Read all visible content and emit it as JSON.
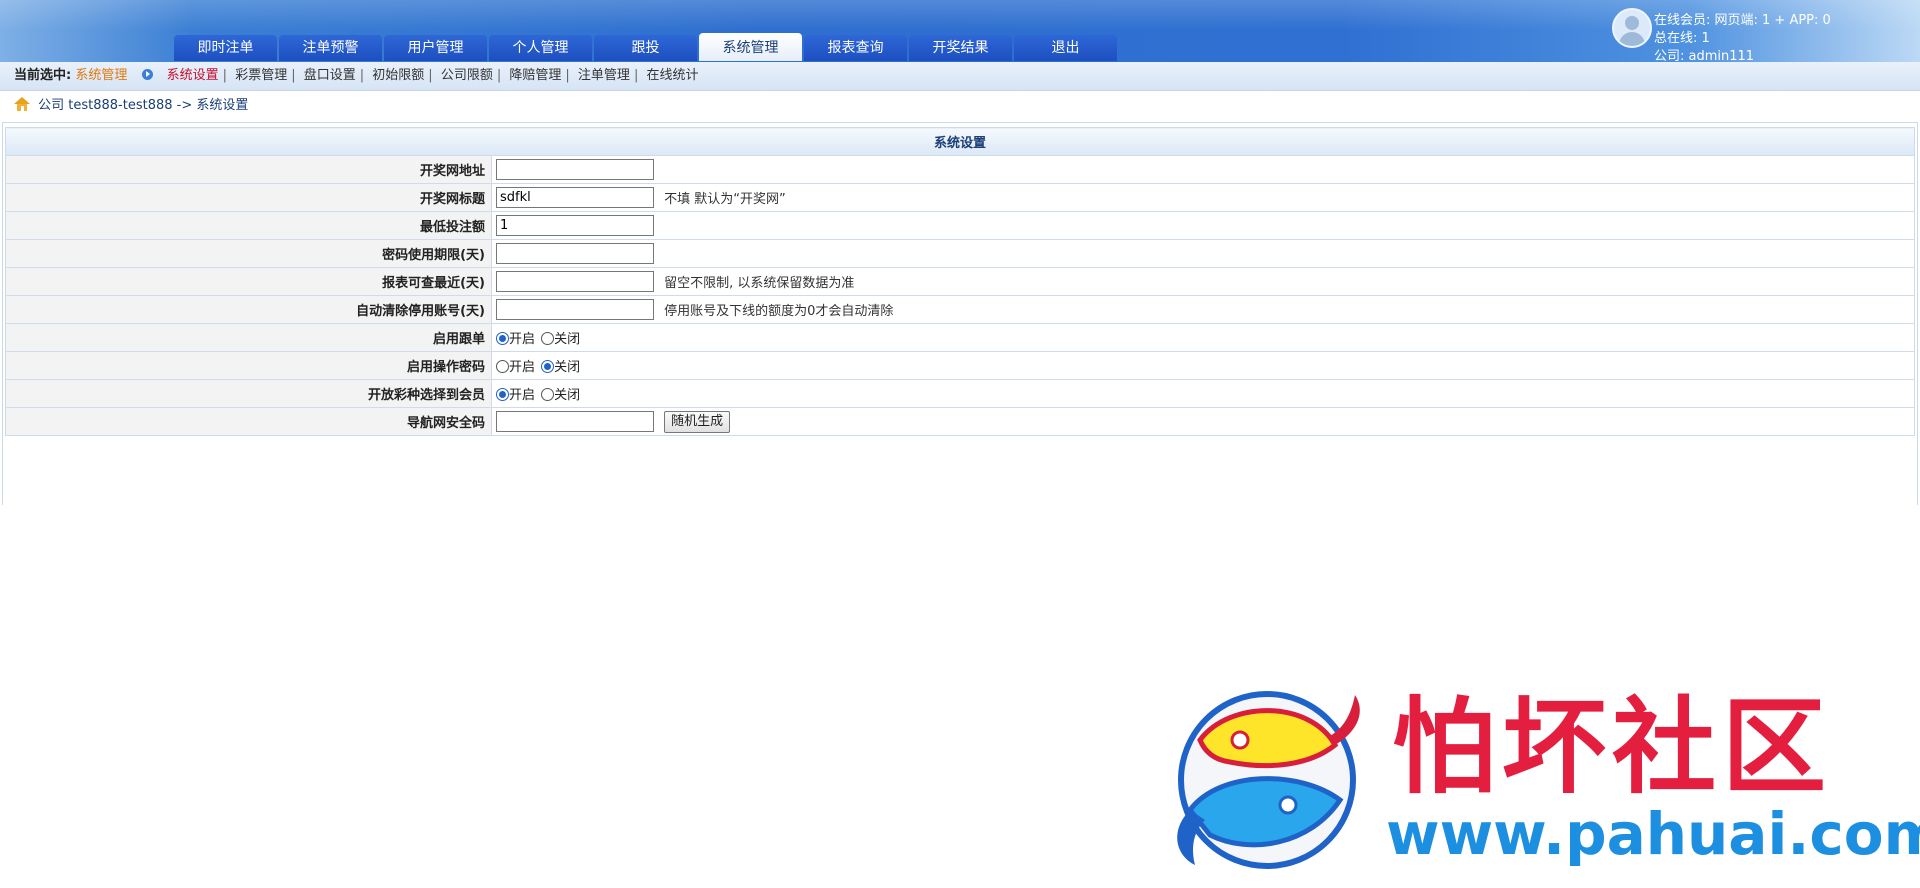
{
  "header": {
    "tabs": [
      {
        "label": "即时注单",
        "active": false
      },
      {
        "label": "注单预警",
        "active": false
      },
      {
        "label": "用户管理",
        "active": false
      },
      {
        "label": "个人管理",
        "active": false
      },
      {
        "label": "跟投",
        "active": false
      },
      {
        "label": "系统管理",
        "active": true
      },
      {
        "label": "报表查询",
        "active": false
      },
      {
        "label": "开奖结果",
        "active": false
      },
      {
        "label": "退出",
        "active": false
      }
    ],
    "user": {
      "online_members": "在线会员:  网页端: 1 + APP: 0",
      "total_online": "总在线: 1",
      "company": "公司: admin111"
    }
  },
  "subnav": {
    "current_label": "当前选中:",
    "current_value": "系统管理",
    "links": [
      "系统设置",
      "彩票管理",
      "盘口设置",
      "初始限额",
      "公司限额",
      "降赔管理",
      "注单管理",
      "在线统计"
    ],
    "active_link": "系统设置"
  },
  "breadcrumb": {
    "text": "公司 test888-test888 -> 系统设置"
  },
  "settings": {
    "title": "系统设置",
    "rows": [
      {
        "label": "开奖网地址",
        "type": "text",
        "value": "",
        "hint": ""
      },
      {
        "label": "开奖网标题",
        "type": "text",
        "value": "sdfkl",
        "hint": "不填 默认为“开奖网”"
      },
      {
        "label": "最低投注额",
        "type": "text",
        "value": "1",
        "hint": ""
      },
      {
        "label": "密码使用期限(天)",
        "type": "text",
        "value": "",
        "hint": ""
      },
      {
        "label": "报表可查最近(天)",
        "type": "text",
        "value": "",
        "hint": "留空不限制, 以系统保留数据为准"
      },
      {
        "label": "自动清除停用账号(天)",
        "type": "text",
        "value": "",
        "hint": "停用账号及下线的额度为0才会自动清除"
      },
      {
        "label": "启用跟单",
        "type": "radio",
        "options": [
          "开启",
          "关闭"
        ],
        "selected": "开启"
      },
      {
        "label": "启用操作密码",
        "type": "radio",
        "options": [
          "开启",
          "关闭"
        ],
        "selected": "关闭"
      },
      {
        "label": "开放彩种选择到会员",
        "type": "radio",
        "options": [
          "开启",
          "关闭"
        ],
        "selected": "开启"
      },
      {
        "label": "导航网安全码",
        "type": "text-button",
        "value": "",
        "button": "随机生成"
      }
    ]
  },
  "watermark": {
    "title": "怕坏社区",
    "url": "www.pahuai.com"
  }
}
